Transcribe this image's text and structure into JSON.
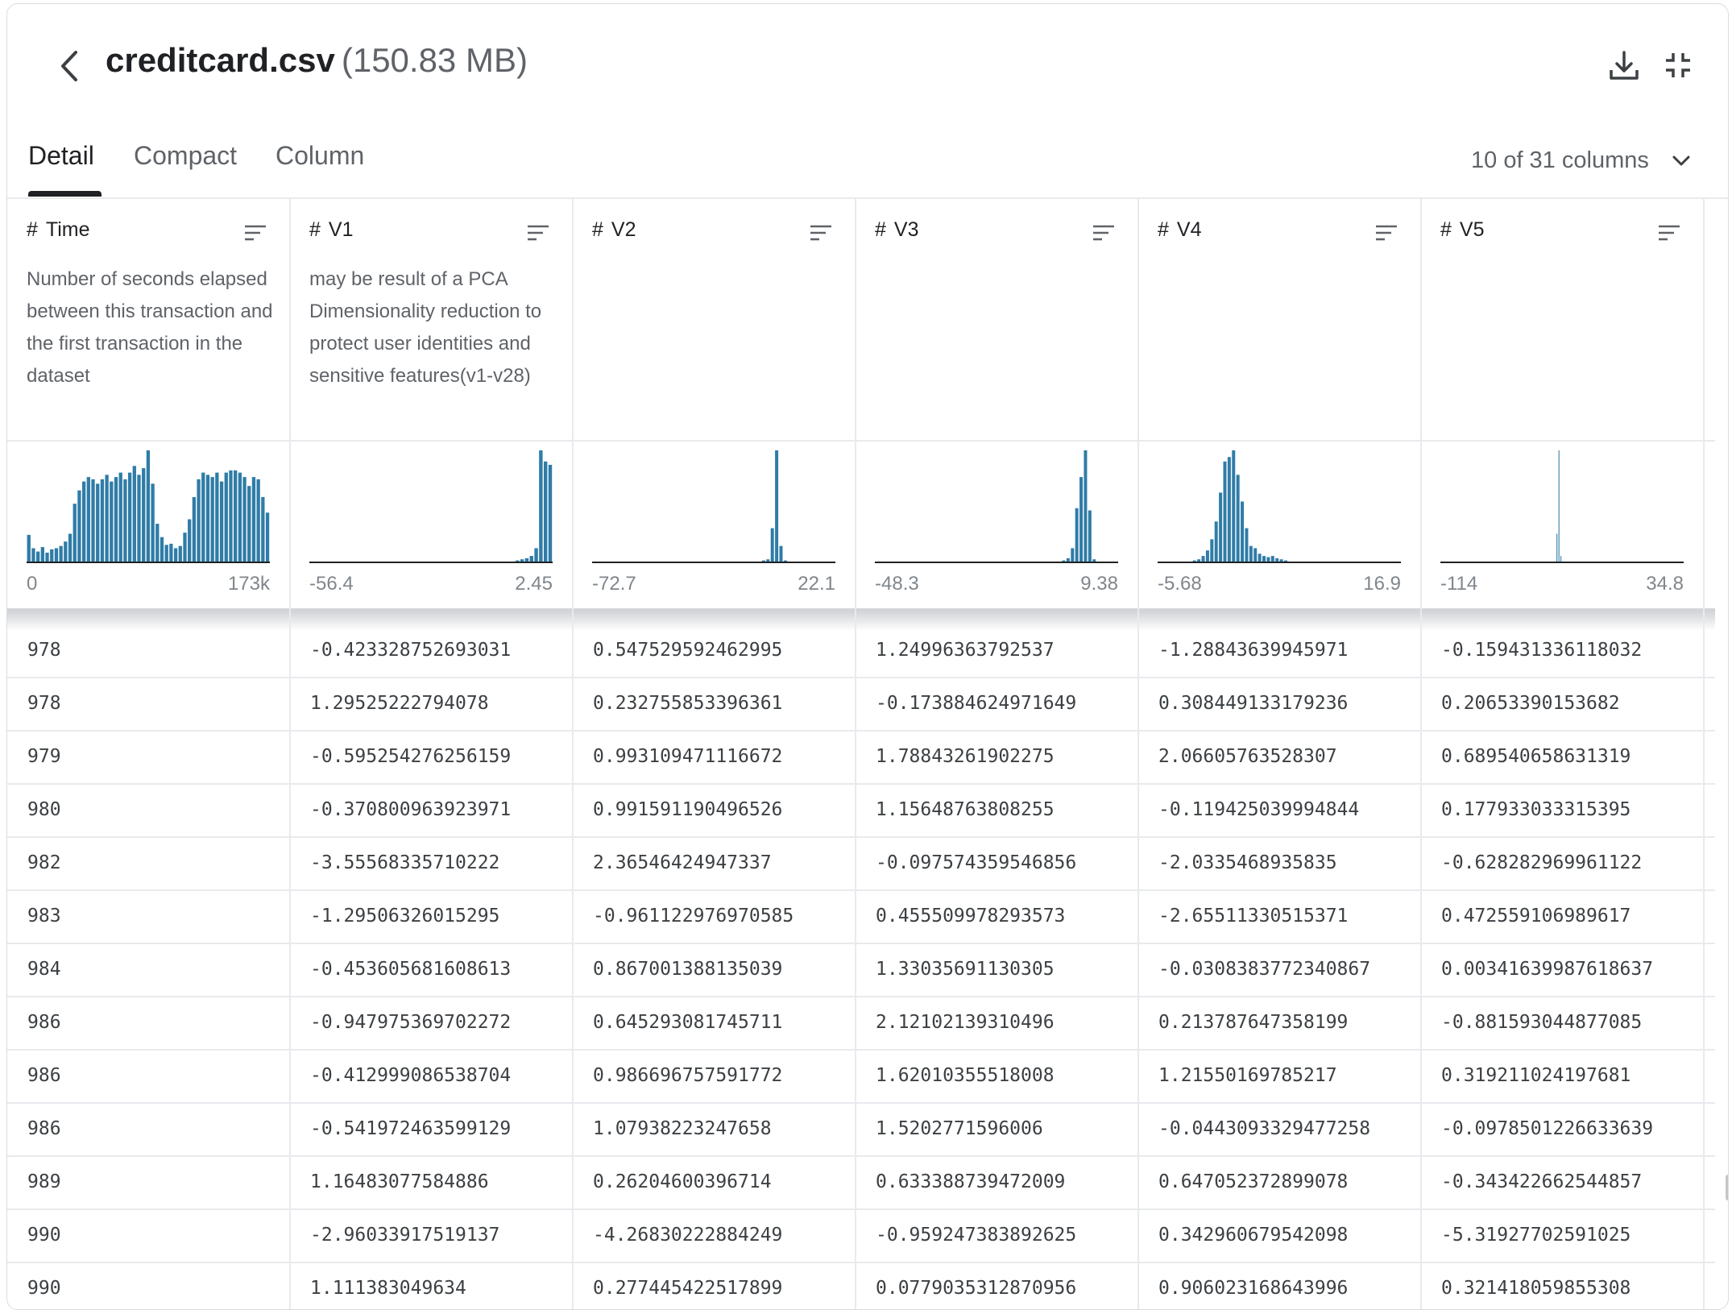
{
  "file": {
    "name": "creditcard.csv",
    "size": "(150.83 MB)"
  },
  "tabs": [
    "Detail",
    "Compact",
    "Column"
  ],
  "column_selector": "10 of 31 columns",
  "columns": [
    {
      "name": "Time",
      "description": "Number of seconds elapsed between this transaction and the first transaction in the dataset",
      "min": "0",
      "max": "173k",
      "hist": [
        24,
        12,
        9,
        13,
        8,
        11,
        12,
        14,
        18,
        25,
        52,
        64,
        72,
        76,
        74,
        70,
        74,
        78,
        72,
        76,
        80,
        74,
        80,
        86,
        78,
        84,
        100,
        70,
        34,
        22,
        15,
        16,
        12,
        14,
        26,
        38,
        58,
        74,
        80,
        78,
        76,
        80,
        72,
        80,
        82,
        82,
        80,
        76,
        68,
        76,
        74,
        58,
        44
      ]
    },
    {
      "name": "V1",
      "description": "may be result of a PCA Dimensionality reduction to protect user identities and sensitive features(v1-v28)",
      "min": "-56.4",
      "max": "2.45",
      "hist": [
        0,
        0,
        0,
        0,
        0,
        0,
        0,
        0,
        0,
        0,
        0,
        0,
        0,
        0,
        0,
        0,
        0,
        0,
        0,
        0,
        0,
        0,
        0,
        0,
        0,
        0,
        0,
        0,
        0,
        0,
        0,
        0,
        0,
        0,
        0,
        0,
        0,
        0,
        0,
        0,
        0,
        0,
        0,
        0,
        1,
        2,
        3,
        5,
        12,
        100,
        90,
        87
      ]
    },
    {
      "name": "V2",
      "description": "",
      "min": "-72.7",
      "max": "22.1",
      "hist": [
        0,
        0,
        0,
        0,
        0,
        0,
        0,
        0,
        0,
        0,
        0,
        0,
        0,
        0,
        0,
        0,
        0,
        0,
        0,
        0,
        0,
        0,
        0,
        0,
        0,
        0,
        0,
        0,
        0,
        0,
        0,
        0,
        0,
        0,
        0,
        0,
        0,
        0,
        0,
        1,
        2,
        30,
        100,
        14,
        1,
        0,
        0,
        0,
        0,
        0,
        0,
        0,
        0,
        0,
        0,
        0
      ]
    },
    {
      "name": "V3",
      "description": "",
      "min": "-48.3",
      "max": "9.38",
      "hist_log": "none",
      "hist": [
        0,
        0,
        0,
        0,
        0,
        0,
        0,
        0,
        0,
        0,
        0,
        0,
        0,
        0,
        0,
        0,
        0,
        0,
        0,
        0,
        0,
        0,
        0,
        0,
        0,
        0,
        0,
        0,
        0,
        0,
        0,
        0,
        0,
        0,
        0,
        0,
        0,
        0,
        0,
        0,
        0,
        0,
        0,
        1,
        3,
        12,
        48,
        76,
        100,
        46,
        2,
        0,
        0,
        0,
        0,
        0
      ]
    },
    {
      "name": "V4",
      "description": "",
      "min": "-5.68",
      "max": "16.9",
      "hist": [
        0,
        0,
        0,
        0,
        0,
        0,
        0,
        0,
        1,
        2,
        5,
        10,
        20,
        36,
        62,
        90,
        94,
        100,
        78,
        54,
        30,
        14,
        12,
        7,
        5,
        4,
        5,
        3,
        2,
        1,
        0,
        0,
        0,
        0,
        0,
        0,
        0,
        0,
        0,
        0,
        0,
        0,
        0,
        0,
        0,
        0,
        0,
        0,
        0,
        0,
        0,
        0,
        0,
        0,
        0,
        0
      ]
    },
    {
      "name": "V5",
      "description": "",
      "min": "-114",
      "max": "34.8",
      "hist": [
        0,
        0,
        0,
        0,
        0,
        0,
        0,
        0,
        0,
        0,
        0,
        0,
        0,
        0,
        0,
        0,
        0,
        0,
        0,
        0,
        0,
        0,
        0,
        0,
        0,
        0,
        0,
        0,
        0,
        0,
        0,
        0,
        0,
        0,
        0,
        0,
        0,
        0,
        0,
        0,
        0,
        0,
        0,
        0,
        0,
        0,
        0,
        0,
        0,
        0,
        0,
        0,
        0,
        0,
        0,
        0,
        0,
        0,
        25,
        100,
        5,
        0,
        0,
        0,
        0,
        0,
        0,
        0,
        0,
        0,
        0,
        0,
        0,
        0,
        0,
        0,
        0,
        0,
        0,
        0,
        0,
        0,
        0,
        0,
        0,
        0,
        0,
        0,
        0,
        0,
        0,
        0,
        0,
        0,
        0,
        0,
        0,
        0,
        0,
        0,
        0,
        0,
        0,
        0,
        0,
        0,
        0,
        0,
        0,
        0,
        0,
        0,
        0,
        0,
        0,
        0,
        0,
        0,
        0,
        0,
        0,
        0
      ]
    }
  ],
  "rows": [
    [
      "978",
      "-0.423328752693031",
      "0.547529592462995",
      "1.24996363792537",
      "-1.28843639945971",
      "-0.159431336118032"
    ],
    [
      "978",
      "1.29525222794078",
      "0.232755853396361",
      "-0.173884624971649",
      "0.308449133179236",
      "0.20653390153682"
    ],
    [
      "979",
      "-0.595254276256159",
      "0.993109471116672",
      "1.78843261902275",
      "2.06605763528307",
      "0.689540658631319"
    ],
    [
      "980",
      "-0.370800963923971",
      "0.991591190496526",
      "1.15648763808255",
      "-0.119425039994844",
      "0.177933033315395"
    ],
    [
      "982",
      "-3.55568335710222",
      "2.36546424947337",
      "-0.097574359546856",
      "-2.0335468935835",
      "-0.628282969961122"
    ],
    [
      "983",
      "-1.29506326015295",
      "-0.961122976970585",
      "0.455509978293573",
      "-2.65511330515371",
      "0.472559106989617"
    ],
    [
      "984",
      "-0.453605681608613",
      "0.867001388135039",
      "1.33035691130305",
      "-0.0308383772340867",
      "0.00341639987618637"
    ],
    [
      "986",
      "-0.947975369702272",
      "0.645293081745711",
      "2.12102139310496",
      "0.213787647358199",
      "-0.881593044877085"
    ],
    [
      "986",
      "-0.412999086538704",
      "0.986696757591772",
      "1.62010355518008",
      "1.21550169785217",
      "0.319211024197681"
    ],
    [
      "986",
      "-0.541972463599129",
      "1.07938223247658",
      "1.5202771596006",
      "-0.0443093329477258",
      "-0.0978501226633639"
    ],
    [
      "989",
      "1.16483077584886",
      "0.26204600396714",
      "0.633388739472009",
      "0.647052372899078",
      "-0.343422662544857"
    ],
    [
      "990",
      "-2.96033917519137",
      "-4.26830222884249",
      "-0.959247383892625",
      "0.342960679542098",
      "-5.31927702591025"
    ],
    [
      "990",
      "1.111383049634",
      "0.277445422517899",
      "0.0779035312870956",
      "0.906023168643996",
      "0.321418059855308"
    ]
  ],
  "colors": {
    "bar": "#2f7ca7",
    "text": "#202124",
    "muted": "#5f6368"
  }
}
